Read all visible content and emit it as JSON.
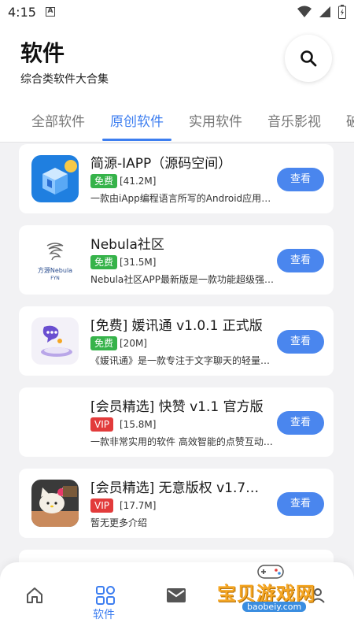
{
  "status_bar": {
    "time": "4:15",
    "notification_letter": "A"
  },
  "header": {
    "title": "软件",
    "subtitle": "综合类软件大合集",
    "search_icon": "search-icon"
  },
  "tabs": [
    {
      "label": "全部软件",
      "active": false
    },
    {
      "label": "原创软件",
      "active": true
    },
    {
      "label": "实用软件",
      "active": false
    },
    {
      "label": "音乐影视",
      "active": false
    },
    {
      "label": "破",
      "active": false
    }
  ],
  "apps": [
    {
      "name": "简源-IAPP（源码空间）",
      "badge": "免费",
      "badge_type": "free",
      "size": "[41.2M]",
      "desc": "一款由iApp编程语言所写的Android应用程序",
      "button": "查看"
    },
    {
      "name": "Nebula社区",
      "badge": "免费",
      "badge_type": "free",
      "size": "[31.5M]",
      "desc": "Nebula社区APP最新版是一款功能超级强大的",
      "button": "查看",
      "icon_text": "方源Nebula",
      "icon_subtext": "FYN"
    },
    {
      "name": "[免费] 媛讯通  v1.0.1 正式版",
      "badge": "免费",
      "badge_type": "free",
      "size": "[20M]",
      "desc": "《媛讯通》是一款专注于文字聊天的轻量级应用",
      "button": "查看"
    },
    {
      "name": "[会员精选] 快赞 v1.1 官方版",
      "badge": "VIP",
      "badge_type": "vip",
      "size": "[15.8M]",
      "desc": "一款非常实用的软件 高效智能的点赞互动神器",
      "button": "查看"
    },
    {
      "name": "[会员精选] 无意版权 v1.7…",
      "badge": "VIP",
      "badge_type": "vip",
      "size": "[17.7M]",
      "desc": "暂无更多介绍",
      "button": "查看"
    }
  ],
  "bottom_nav": {
    "items": [
      "home-icon",
      "software-grid-icon",
      "mail-icon",
      "user-icon"
    ],
    "active_label": "软件"
  },
  "watermark": {
    "text": "宝贝游戏网",
    "url": "baobeiy.com"
  },
  "colors": {
    "accent": "#3d7ef0",
    "free": "#36b34a",
    "vip": "#e23b3b",
    "button": "#4a86ee"
  }
}
